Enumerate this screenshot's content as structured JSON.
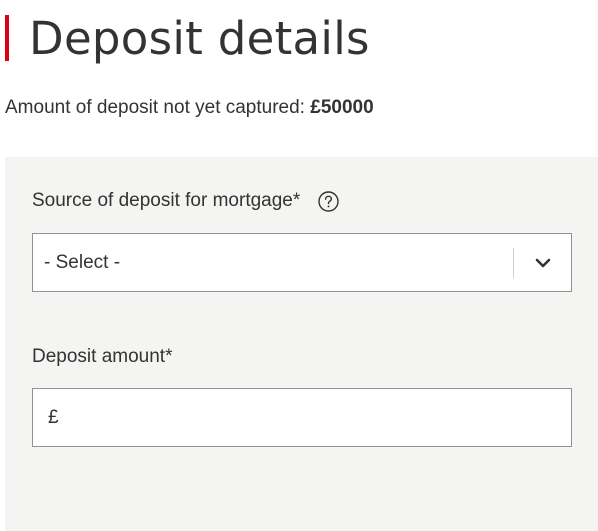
{
  "header": {
    "title": "Deposit details",
    "accent_color": "#db0011"
  },
  "summary": {
    "label": "Amount of deposit not yet captured:",
    "amount": "£50000"
  },
  "form": {
    "source": {
      "label": "Source of deposit for mortgage*",
      "help_icon": "question-circle-icon",
      "selected_value": "- Select -",
      "dropdown_icon": "chevron-down-icon"
    },
    "amount": {
      "label": "Deposit amount*",
      "currency_symbol": "£",
      "value": "",
      "placeholder": ""
    }
  },
  "colors": {
    "panel_background": "#f4f4f2",
    "input_border": "#929292",
    "text": "#333333"
  }
}
